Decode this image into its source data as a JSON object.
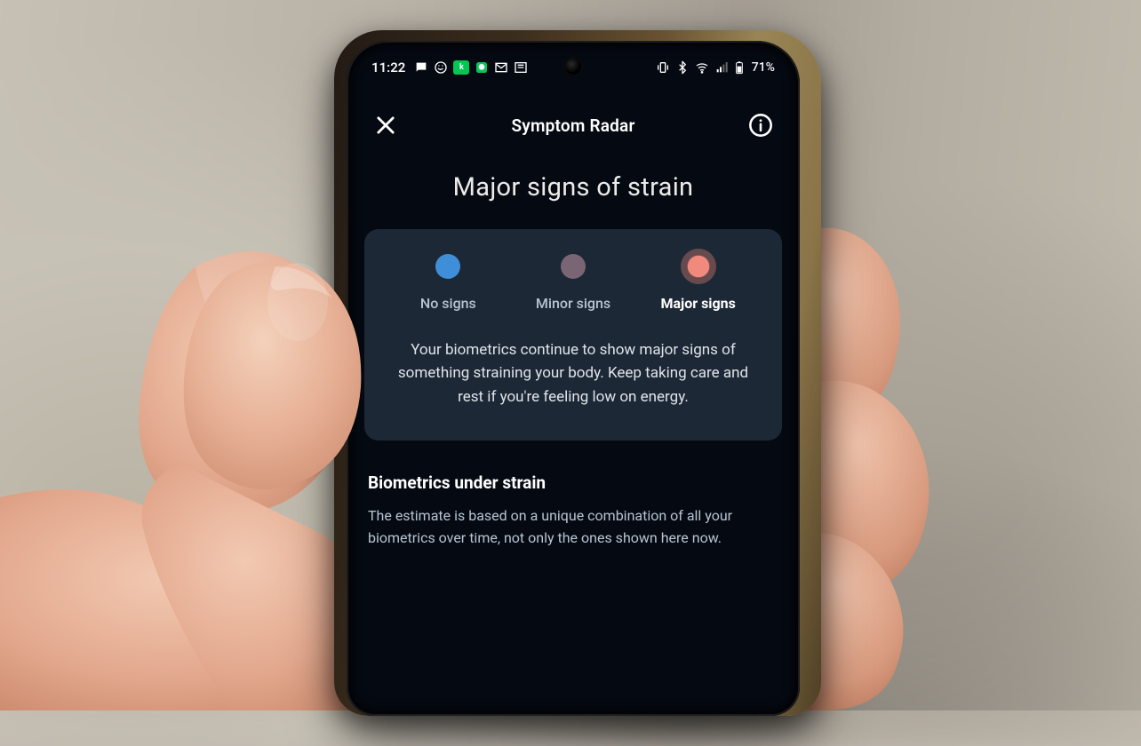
{
  "status_bar": {
    "time": "11:22",
    "battery_text": "71%"
  },
  "header": {
    "title": "Symptom Radar"
  },
  "main": {
    "heading": "Major signs of strain",
    "levels": [
      {
        "label": "No signs",
        "color": "blue",
        "active": false
      },
      {
        "label": "Minor signs",
        "color": "mauve",
        "active": false
      },
      {
        "label": "Major signs",
        "color": "coral",
        "active": true
      }
    ],
    "card_message": "Your biometrics continue to show major signs of something straining your body. Keep taking care and rest if you're feeling low on energy."
  },
  "section": {
    "title": "Biometrics under strain",
    "body": "The estimate is based on a unique combination of all your biometrics over time, not only the ones shown here now."
  }
}
